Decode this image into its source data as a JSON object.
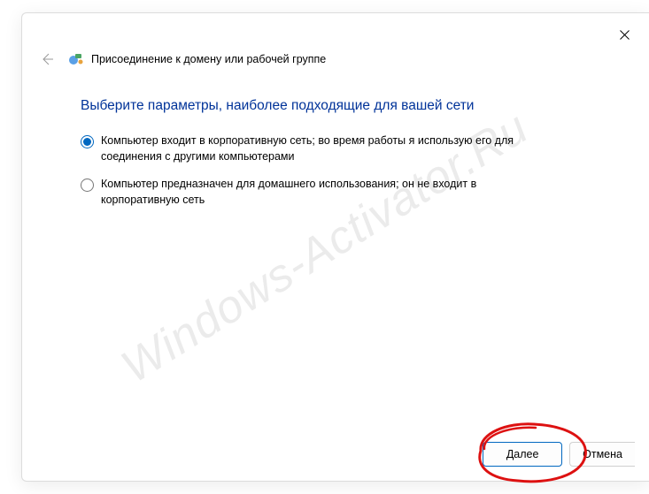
{
  "watermark": "Windows-Activator.Ru",
  "wizard": {
    "title": "Присоединение к домену или рабочей группе",
    "heading": "Выберите параметры, наиболее подходящие для вашей сети",
    "options": [
      {
        "label": "Компьютер входит в корпоративную сеть; во время работы я использую его для соединения с другими компьютерами",
        "selected": true
      },
      {
        "label": "Компьютер предназначен для домашнего использования; он не входит в корпоративную сеть",
        "selected": false
      }
    ],
    "buttons": {
      "next": "Далее",
      "cancel": "Отмена"
    }
  }
}
